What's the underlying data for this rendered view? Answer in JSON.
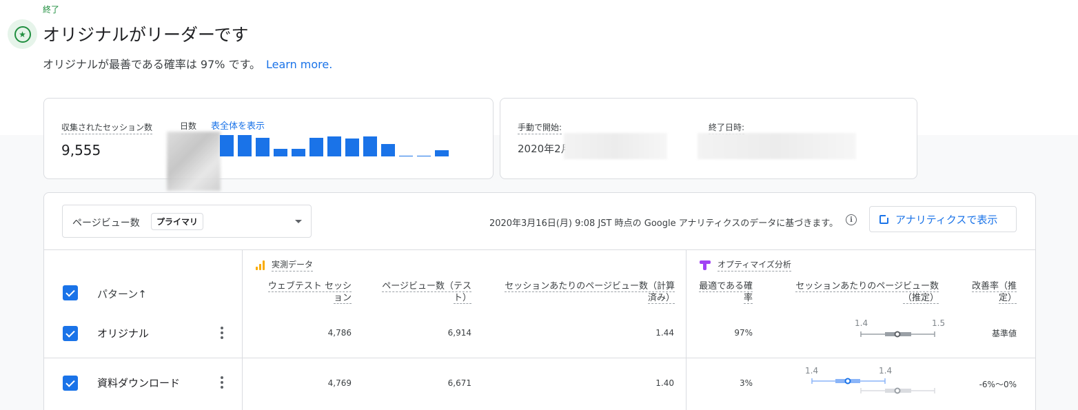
{
  "header": {
    "status": "終了",
    "title": "オリジナルがリーダーです",
    "subtitle": "オリジナルが最善である確率は 97% です。",
    "learn_more": "Learn more."
  },
  "sessions_card": {
    "label": "収集されたセッション数",
    "value": "9,555",
    "days_label": "日数",
    "show_all": "表全体を表示",
    "daily_bars": [
      0.7,
      0.7,
      0.62,
      0.25,
      0.25,
      0.62,
      0.65,
      0.6,
      0.65,
      0.4,
      0.02,
      0.02,
      0.2
    ]
  },
  "dates_card": {
    "start_label": "手動で開始:",
    "start_value": "2020年2月",
    "end_label": "終了日時:"
  },
  "toolbar": {
    "metric": "ページビュー数",
    "metric_chip": "プライマリ",
    "data_note": "2020年3月16日(月) 9:08 JST 時点の Google アナリティクスのデータに基づきます。",
    "ga_button": "アナリティクスで表示"
  },
  "table": {
    "pattern_header": "パターン↑",
    "measured_section": "実測データ",
    "optimize_section": "オプティマイズ分析",
    "columns": {
      "sessions": [
        "ウェブテスト セッシ",
        "ョン"
      ],
      "pageviews": [
        "ページビュー数（テス",
        "ト）"
      ],
      "pv_per_session_calc": [
        "セッションあたりのページビュー数（計算",
        "済み）"
      ],
      "prob_best": [
        "最適である確",
        "率"
      ],
      "pv_per_session_est": [
        "セッションあたりのページビュー数",
        "（推定）"
      ],
      "improvement": [
        "改善率（推",
        "定）"
      ]
    },
    "rows": [
      {
        "name": "オリジナル",
        "sessions": "4,786",
        "pageviews": "6,914",
        "pv_per_session": "1.44",
        "prob_best": "97%",
        "ci_ticks": [
          "1.4",
          "1.5"
        ],
        "improvement": "基準値"
      },
      {
        "name": "資料ダウンロード",
        "sessions": "4,769",
        "pageviews": "6,671",
        "pv_per_session": "1.40",
        "prob_best": "3%",
        "ci_ticks": [
          "1.4",
          "1.4"
        ],
        "improvement": "-6%〜0%"
      }
    ]
  },
  "colors": {
    "accent": "#1a73e8",
    "success": "#1e8e3e",
    "ga_orange": "#f9ab00",
    "optimize_purple": "#a142f4"
  }
}
